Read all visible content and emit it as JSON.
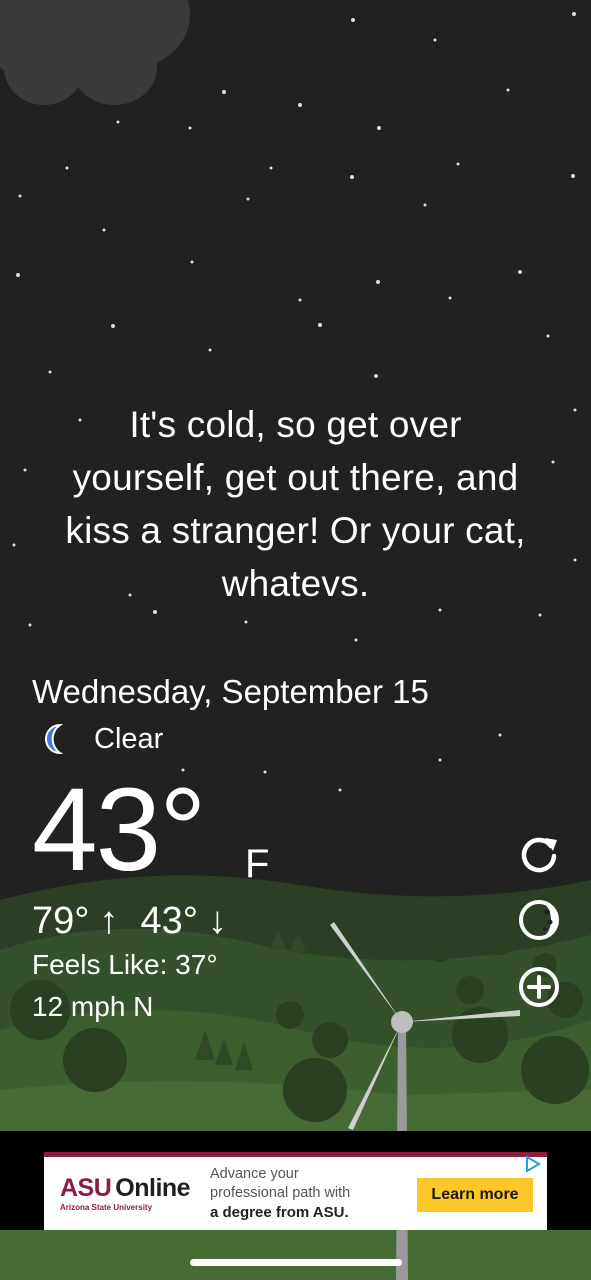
{
  "message": {
    "line1": "It's cold, so get over",
    "line2": "yourself, get out there, and",
    "line3": "kiss a stranger! Or your cat,",
    "line4": "whatevs."
  },
  "weather": {
    "date": "Wednesday, September 15",
    "condition": "Clear",
    "condition_icon": "moon-icon",
    "temperature": "43°",
    "unit": "F",
    "high": "79°",
    "low": "43°",
    "high_arrow": "↑",
    "low_arrow": "↓",
    "feels_like": "Feels Like: 37°",
    "wind": "12 mph N"
  },
  "actions": {
    "refresh_icon": "refresh-icon",
    "moon_phase_icon": "moon-phase-icon",
    "add_icon": "add-icon"
  },
  "ad": {
    "logo_primary": "ASU",
    "logo_secondary": "Online",
    "logo_sub": "Arizona State University",
    "copy_line1": "Advance your",
    "copy_line2": "professional path with",
    "copy_line3": "a degree from ASU.",
    "cta": "Learn more",
    "brand_color": "#8c1d40",
    "cta_color": "#ffc627"
  },
  "colors": {
    "sky": "#212121",
    "hills": "#3d5a2e",
    "text": "#ffffff",
    "moon": "#3f7ad6"
  }
}
